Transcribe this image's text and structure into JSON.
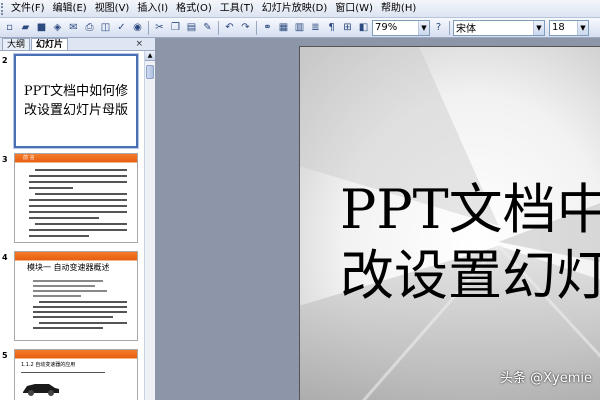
{
  "menubar": {
    "items": [
      "文件(F)",
      "编辑(E)",
      "视图(V)",
      "插入(I)",
      "格式(O)",
      "工具(T)",
      "幻灯片放映(D)",
      "窗口(W)",
      "帮助(H)"
    ]
  },
  "toolbar": {
    "zoom": "79%",
    "font_name": "宋体",
    "font_size": "18",
    "icons": [
      "new-icon",
      "open-icon",
      "save-icon",
      "permission-icon",
      "email-icon",
      "print-icon",
      "print-preview-icon",
      "spelling-icon",
      "research-icon",
      "cut-icon",
      "copy-icon",
      "paste-icon",
      "format-painter-icon",
      "undo-icon",
      "redo-icon",
      "hyperlink-icon",
      "table-icon",
      "chart-icon",
      "expand-icon",
      "show-formatting-icon",
      "grid-icon",
      "grayscale-icon",
      "help-icon"
    ]
  },
  "leftpane": {
    "tabs": [
      "大纲",
      "幻灯片"
    ],
    "close": "×",
    "slides": [
      {
        "number": "2",
        "title": "PPT文档中如何修改设置幻灯片母版",
        "title_line1": "PPT文档中如何修",
        "title_line2": "改设置幻灯片母版"
      },
      {
        "number": "3",
        "bar_label": "前  言"
      },
      {
        "number": "4",
        "heading": "模块一   自动变速器概述"
      },
      {
        "number": "5",
        "subheading": "1.1.2 自动变速器的应用"
      }
    ]
  },
  "slide": {
    "title_line1": "PPT文档中",
    "title_line2": "改设置幻灯"
  },
  "watermark": "头条 @Xyemie",
  "colors": {
    "accent": "#4a6fb5",
    "thumb_bar": "#f47c2a",
    "background": "#8d96a8"
  }
}
